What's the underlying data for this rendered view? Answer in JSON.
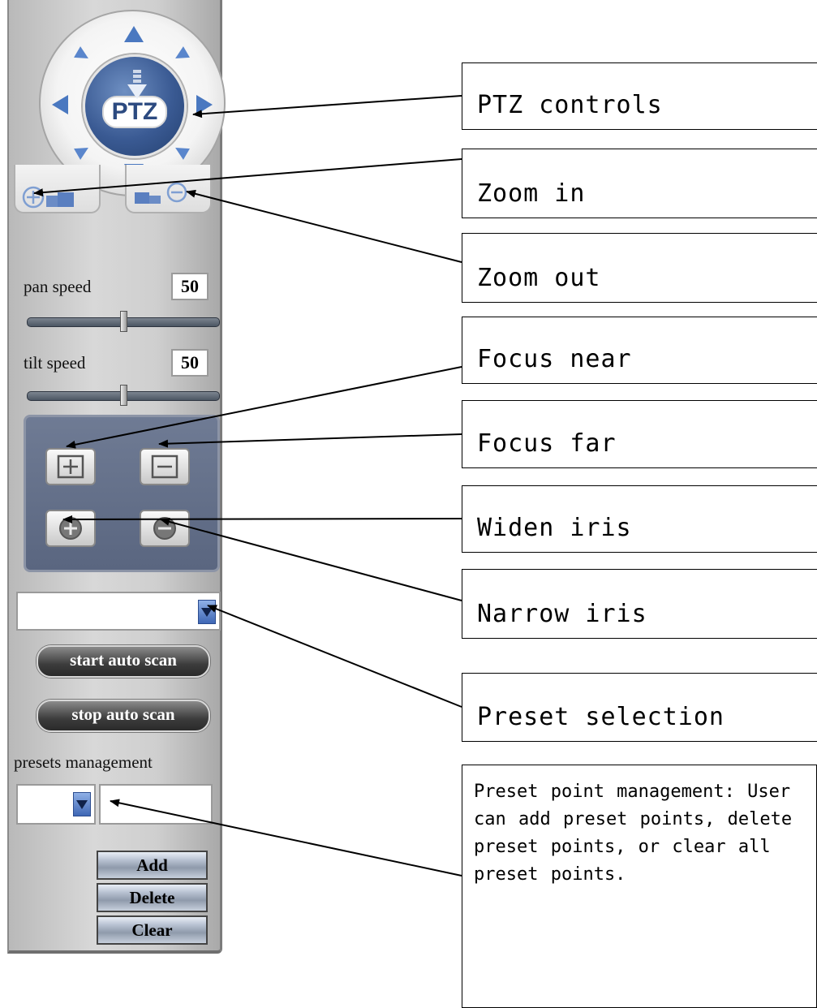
{
  "ptz": {
    "label": "PTZ"
  },
  "speeds": {
    "pan_label": "pan speed",
    "pan_value": "50",
    "pan_fraction": 0.5,
    "tilt_label": "tilt speed",
    "tilt_value": "50",
    "tilt_fraction": 0.5
  },
  "scan": {
    "start_label": "start auto scan",
    "stop_label": "stop auto scan"
  },
  "presets": {
    "management_label": "presets management",
    "add_label": "Add",
    "delete_label": "Delete",
    "clear_label": "Clear"
  },
  "annotations": {
    "ptz_controls": "PTZ controls",
    "zoom_in": "Zoom in",
    "zoom_out": "Zoom out",
    "focus_near": "Focus near",
    "focus_far": "Focus far",
    "widen_iris": "Widen iris",
    "narrow_iris": "Narrow iris",
    "preset_selection": "Preset selection",
    "preset_management": "Preset point management: User can add preset points, delete preset points, or clear all preset points."
  },
  "colors": {
    "accent_blue": "#3a5a93",
    "focus_panel": "#5a6680",
    "panel_gray": "#cfcfcf"
  }
}
